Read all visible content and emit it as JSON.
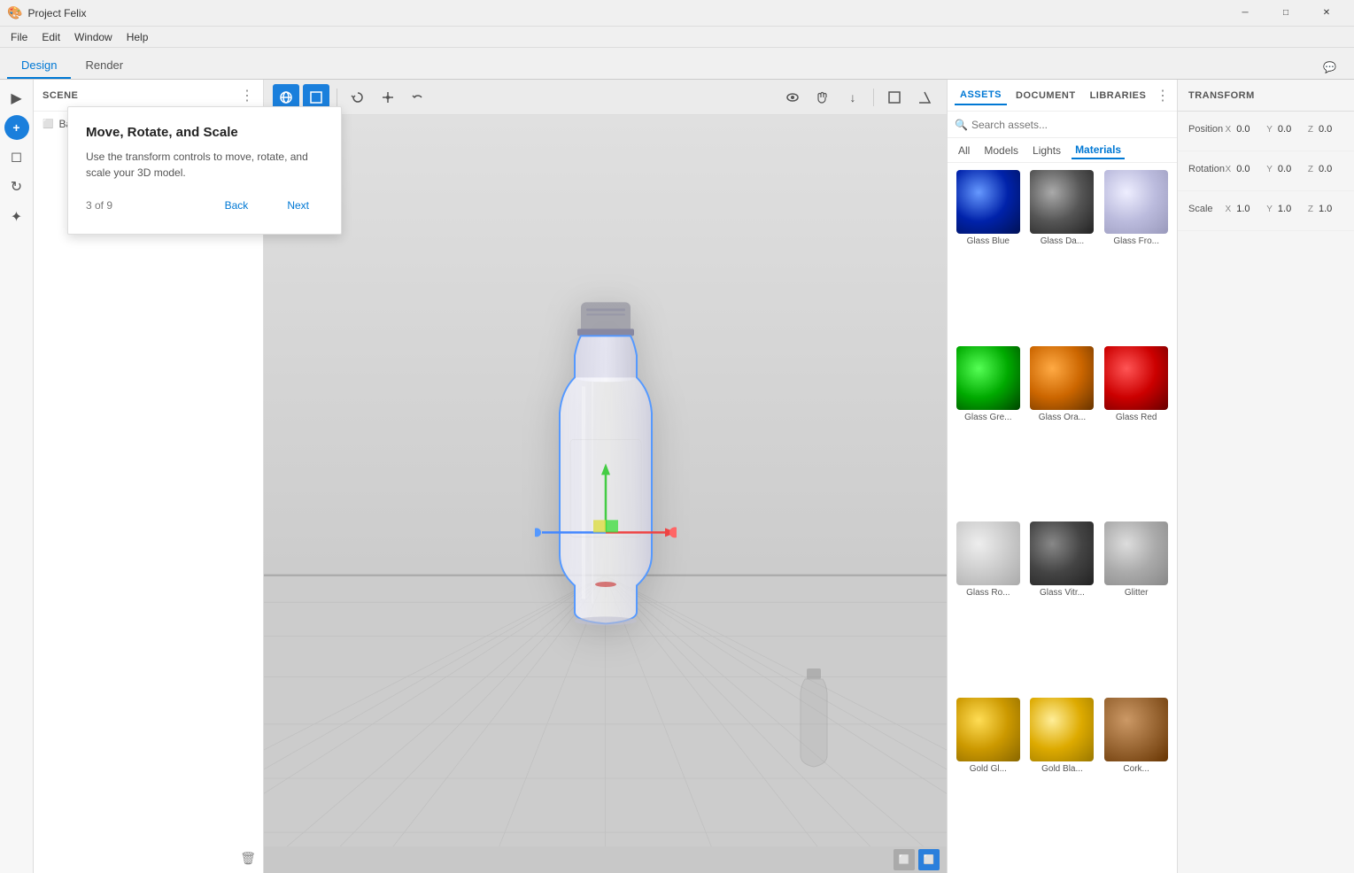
{
  "app": {
    "title": "Project Felix",
    "icon": "🎨"
  },
  "titlebar": {
    "title": "Project Felix",
    "minimize_label": "─",
    "maximize_label": "□",
    "close_label": "✕"
  },
  "menubar": {
    "items": [
      "File",
      "Edit",
      "Window",
      "Help"
    ]
  },
  "tabs": {
    "items": [
      "Design",
      "Render"
    ],
    "active": "Design"
  },
  "toolbar_right_icon": "💬",
  "scene": {
    "title": "SCENE",
    "items": [
      {
        "label": "Background",
        "icon": "⬜"
      }
    ]
  },
  "tooltip": {
    "title": "Move, Rotate, and Scale",
    "description": "Use the transform controls to move, rotate, and scale your 3D model.",
    "progress": "3 of 9",
    "back_label": "Back",
    "next_label": "Next"
  },
  "viewport_toolbar": {
    "tools": [
      {
        "id": "globe",
        "symbol": "🌐",
        "active": true
      },
      {
        "id": "select",
        "symbol": "⬜",
        "active": true
      },
      {
        "id": "rotate",
        "symbol": "↻",
        "active": false
      },
      {
        "id": "pan",
        "symbol": "+",
        "active": false
      },
      {
        "id": "undo",
        "symbol": "↩",
        "active": false
      }
    ],
    "right_tools": [
      {
        "id": "eye",
        "symbol": "👁",
        "active": false
      },
      {
        "id": "hand",
        "symbol": "✋",
        "active": false
      },
      {
        "id": "down",
        "symbol": "↓",
        "active": false
      },
      {
        "id": "box",
        "symbol": "⬜",
        "active": false
      },
      {
        "id": "tri",
        "symbol": "△",
        "active": false
      }
    ]
  },
  "transform": {
    "title": "TRANSFORM",
    "position": {
      "label": "Position",
      "x_label": "X",
      "x_value": "0.0",
      "y_label": "Y",
      "y_value": "0.0",
      "z_label": "Z",
      "z_value": "0.0"
    },
    "rotation": {
      "label": "Rotation",
      "x_label": "X",
      "x_value": "0.0",
      "y_label": "Y",
      "y_value": "0.0",
      "z_label": "Z",
      "z_value": "0.0"
    },
    "scale": {
      "label": "Scale",
      "x_label": "X",
      "x_value": "1.0",
      "y_label": "Y",
      "y_value": "1.0",
      "z_label": "Z",
      "z_value": "1.0"
    }
  },
  "assets": {
    "tabs": [
      "ASSETS",
      "DOCUMENT",
      "LIBRARIES"
    ],
    "active_tab": "ASSETS",
    "search_placeholder": "Search assets...",
    "filter_tabs": [
      "All",
      "Models",
      "Lights",
      "Materials"
    ],
    "active_filter": "Materials",
    "materials": [
      {
        "id": "glass-blue",
        "label": "Glass Blue",
        "class": "mat-glass-blue"
      },
      {
        "id": "glass-dark",
        "label": "Glass Da...",
        "class": "mat-glass-dark"
      },
      {
        "id": "glass-frost",
        "label": "Glass Fro...",
        "class": "mat-glass-frost"
      },
      {
        "id": "glass-green",
        "label": "Glass Gre...",
        "class": "mat-glass-green"
      },
      {
        "id": "glass-orange",
        "label": "Glass Ora...",
        "class": "mat-glass-orange"
      },
      {
        "id": "glass-red",
        "label": "Glass Red",
        "class": "mat-glass-red"
      },
      {
        "id": "glass-rose",
        "label": "Glass Ro...",
        "class": "mat-glass-rose"
      },
      {
        "id": "glass-vitr",
        "label": "Glass Vitr...",
        "class": "mat-glass-vitr"
      },
      {
        "id": "glitter",
        "label": "Glitter",
        "class": "mat-glitter"
      },
      {
        "id": "gold1",
        "label": "Gold Gl...",
        "class": "mat-gold"
      },
      {
        "id": "gold2",
        "label": "Gold Bla...",
        "class": "mat-gold2"
      },
      {
        "id": "cork",
        "label": "Cork...",
        "class": "mat-cork"
      }
    ]
  },
  "left_tools": [
    {
      "id": "select",
      "symbol": "▶",
      "active": false
    },
    {
      "id": "move",
      "symbol": "+",
      "active": true
    },
    {
      "id": "square",
      "symbol": "◻",
      "active": false
    },
    {
      "id": "rotate2",
      "symbol": "↻",
      "active": false
    },
    {
      "id": "magic",
      "symbol": "✦",
      "active": false
    }
  ],
  "colors": {
    "accent": "#0078d4",
    "bg": "#f0f0f0",
    "panel": "#f5f5f5",
    "border": "#ddd"
  }
}
